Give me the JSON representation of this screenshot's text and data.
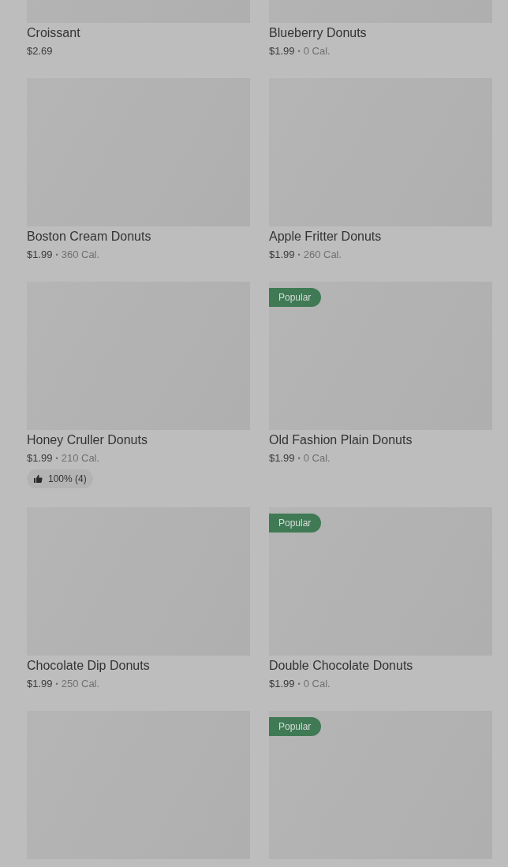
{
  "items": [
    {
      "kind": "product",
      "name": "Croissant",
      "price": "$2.69"
    },
    {
      "kind": "product",
      "name": "Blueberry Donuts",
      "price": "$1.99",
      "separator": "•",
      "calories": "0 Cal."
    },
    {
      "kind": "product",
      "name": "Boston Cream Donuts",
      "price": "$1.99",
      "separator": "•",
      "calories": "360 Cal."
    },
    {
      "kind": "product",
      "name": "Apple Fritter Donuts",
      "price": "$1.99",
      "separator": "•",
      "calories": "260 Cal."
    },
    {
      "kind": "product",
      "name": "Honey Cruller Donuts",
      "price": "$1.99",
      "separator": "•",
      "calories": "210 Cal.",
      "rating": "100% (4)"
    },
    {
      "kind": "product",
      "name": "Old Fashion Plain Donuts",
      "price": "$1.99",
      "separator": "•",
      "calories": "0 Cal.",
      "badge": "Popular"
    },
    {
      "kind": "product",
      "name": "Chocolate Dip Donuts",
      "price": "$1.99",
      "separator": "•",
      "calories": "250 Cal."
    },
    {
      "kind": "product",
      "name": "Double Chocolate Donuts",
      "price": "$1.99",
      "separator": "•",
      "calories": "0 Cal.",
      "badge": "Popular"
    },
    {
      "kind": "product"
    },
    {
      "kind": "product",
      "badge": "Popular"
    }
  ]
}
